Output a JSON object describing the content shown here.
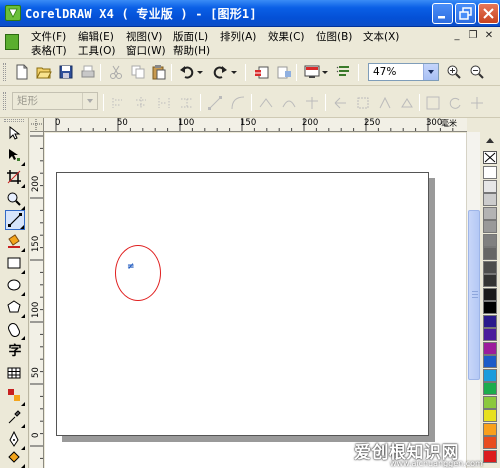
{
  "window": {
    "title": "CorelDRAW X4 ( 专业版 ) - [图形1]",
    "minimize_icon": "minimize-icon",
    "maximize_icon": "maximize-icon",
    "close_icon": "close-icon"
  },
  "menubar": {
    "row1": [
      "文件(F)",
      "编辑(E)",
      "视图(V)",
      "版面(L)",
      "排列(A)",
      "效果(C)",
      "位图(B)",
      "文本(X)"
    ],
    "row2": [
      "表格(T)",
      "工具(O)",
      "窗口(W)",
      "帮助(H)"
    ]
  },
  "toolbar": {
    "icons": [
      "new-icon",
      "open-icon",
      "save-icon",
      "print-icon",
      "cut-icon",
      "copy-icon",
      "paste-icon",
      "undo-icon",
      "redo-icon",
      "import-icon",
      "export-icon",
      "app-launcher-icon",
      "welcome-icon",
      "zoom-in-icon",
      "zoom-out-icon"
    ],
    "zoom_value": "47%"
  },
  "property_bar": {
    "object_type": "矩形"
  },
  "toolbox": {
    "text_tool_label": "字",
    "tools": [
      "pick-tool",
      "shape-tool",
      "crop-tool",
      "zoom-tool",
      "freehand-tool",
      "smart-fill-tool",
      "rectangle-tool",
      "ellipse-tool",
      "polygon-tool",
      "basic-shapes-tool",
      "text-tool",
      "table-tool",
      "interactive-blend-tool",
      "eyedropper-tool",
      "outline-tool",
      "fill-tool"
    ]
  },
  "ruler": {
    "horizontal_labels": [
      "0",
      "50",
      "100",
      "150",
      "200",
      "250",
      "300"
    ],
    "unit": "毫米",
    "vertical_labels": [
      "200",
      "150",
      "100",
      "50",
      "0"
    ]
  },
  "canvas": {
    "mark_glyph": "≠"
  },
  "palette": {
    "colors": [
      "#FFFFFF",
      "#E6E6E6",
      "#CCCCCC",
      "#B3B3B3",
      "#999999",
      "#808080",
      "#666666",
      "#4D4D4D",
      "#333333",
      "#1A1A1A",
      "#000000",
      "#2A1A8C",
      "#4A1C9C",
      "#9C1C9C",
      "#1C5CC8",
      "#1C9CDC",
      "#1CAC4C",
      "#8CC83C",
      "#E8E01C",
      "#F8A01C",
      "#E84C1C",
      "#DC1C1C"
    ]
  },
  "watermark": {
    "text": "爱创根知识网",
    "url": "www.aichuanggen.com"
  }
}
